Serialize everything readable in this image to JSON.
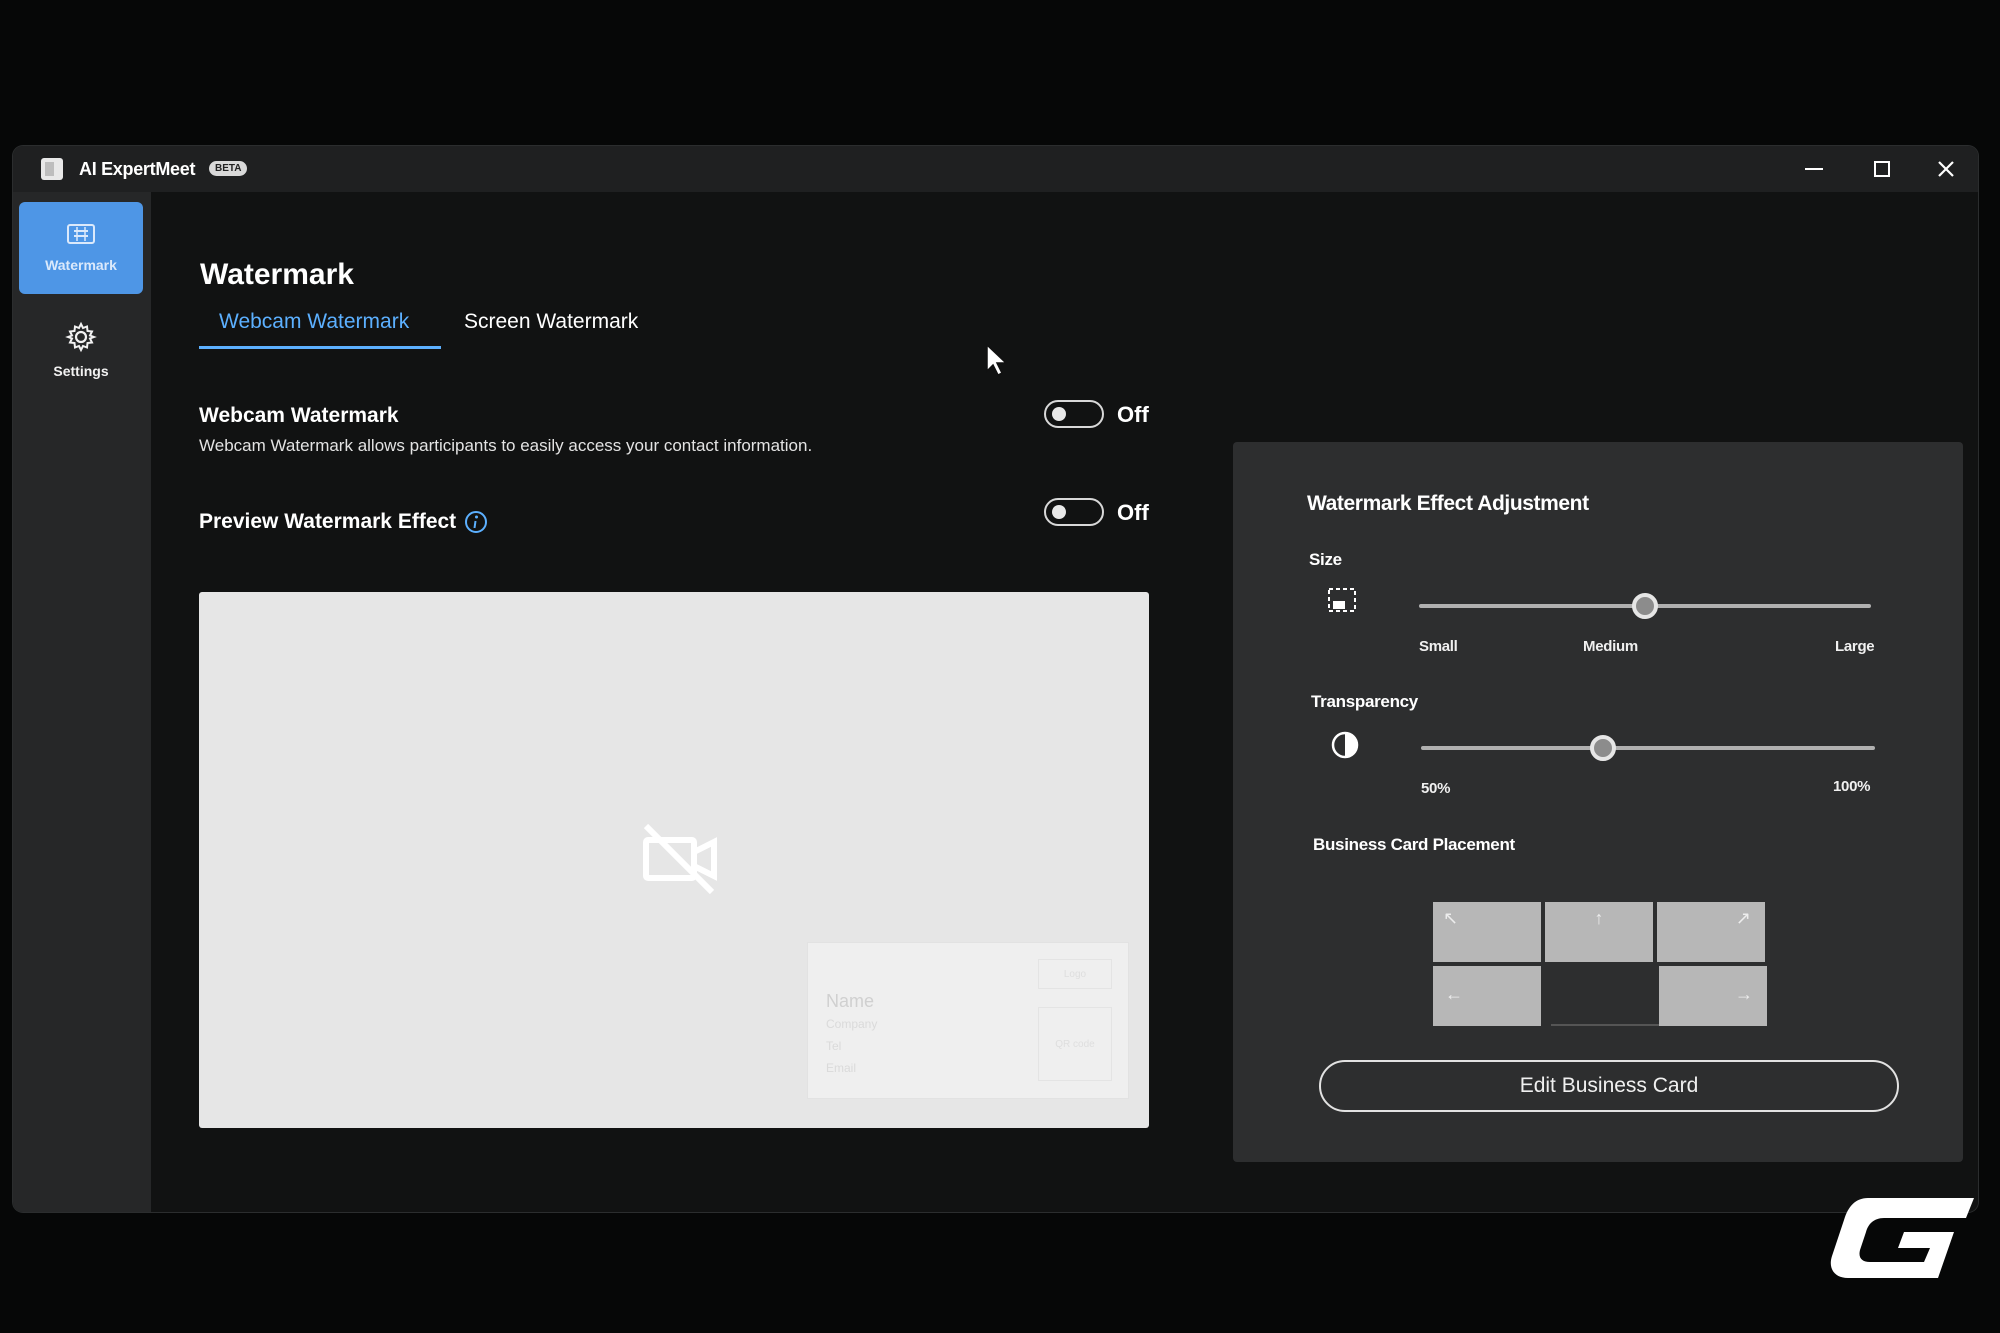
{
  "app": {
    "title": "AI ExpertMeet",
    "badge": "BETA"
  },
  "sidebar": {
    "items": [
      {
        "label": "Watermark",
        "icon": "watermark-icon",
        "active": true
      },
      {
        "label": "Settings",
        "icon": "gear-icon",
        "active": false
      }
    ]
  },
  "page": {
    "title": "Watermark"
  },
  "tabs": [
    {
      "label": "Webcam Watermark",
      "active": true
    },
    {
      "label": "Screen Watermark",
      "active": false
    }
  ],
  "webcam_watermark": {
    "title": "Webcam Watermark",
    "description": "Webcam Watermark allows participants to easily access your contact information.",
    "toggle_state": "Off"
  },
  "preview": {
    "title": "Preview Watermark Effect",
    "toggle_state": "Off",
    "card": {
      "name": "Name",
      "company": "Company",
      "tel": "Tel",
      "email": "Email",
      "logo": "Logo",
      "qr": "QR code"
    }
  },
  "adjustment": {
    "title": "Watermark Effect Adjustment",
    "size": {
      "label": "Size",
      "ticks": [
        "Small",
        "Medium",
        "Large"
      ],
      "value": 0.5
    },
    "transparency": {
      "label": "Transparency",
      "min_label": "50%",
      "max_label": "100%",
      "value": 0.4
    },
    "placement": {
      "label": "Business Card Placement",
      "arrows": [
        "↖",
        "↑",
        "↗",
        "←",
        "→"
      ]
    },
    "edit_button": "Edit Business Card"
  },
  "colors": {
    "accent": "#5cb0ff",
    "active_nav": "#4e96e6",
    "panel": "#2d2e2f",
    "background": "#111212"
  }
}
